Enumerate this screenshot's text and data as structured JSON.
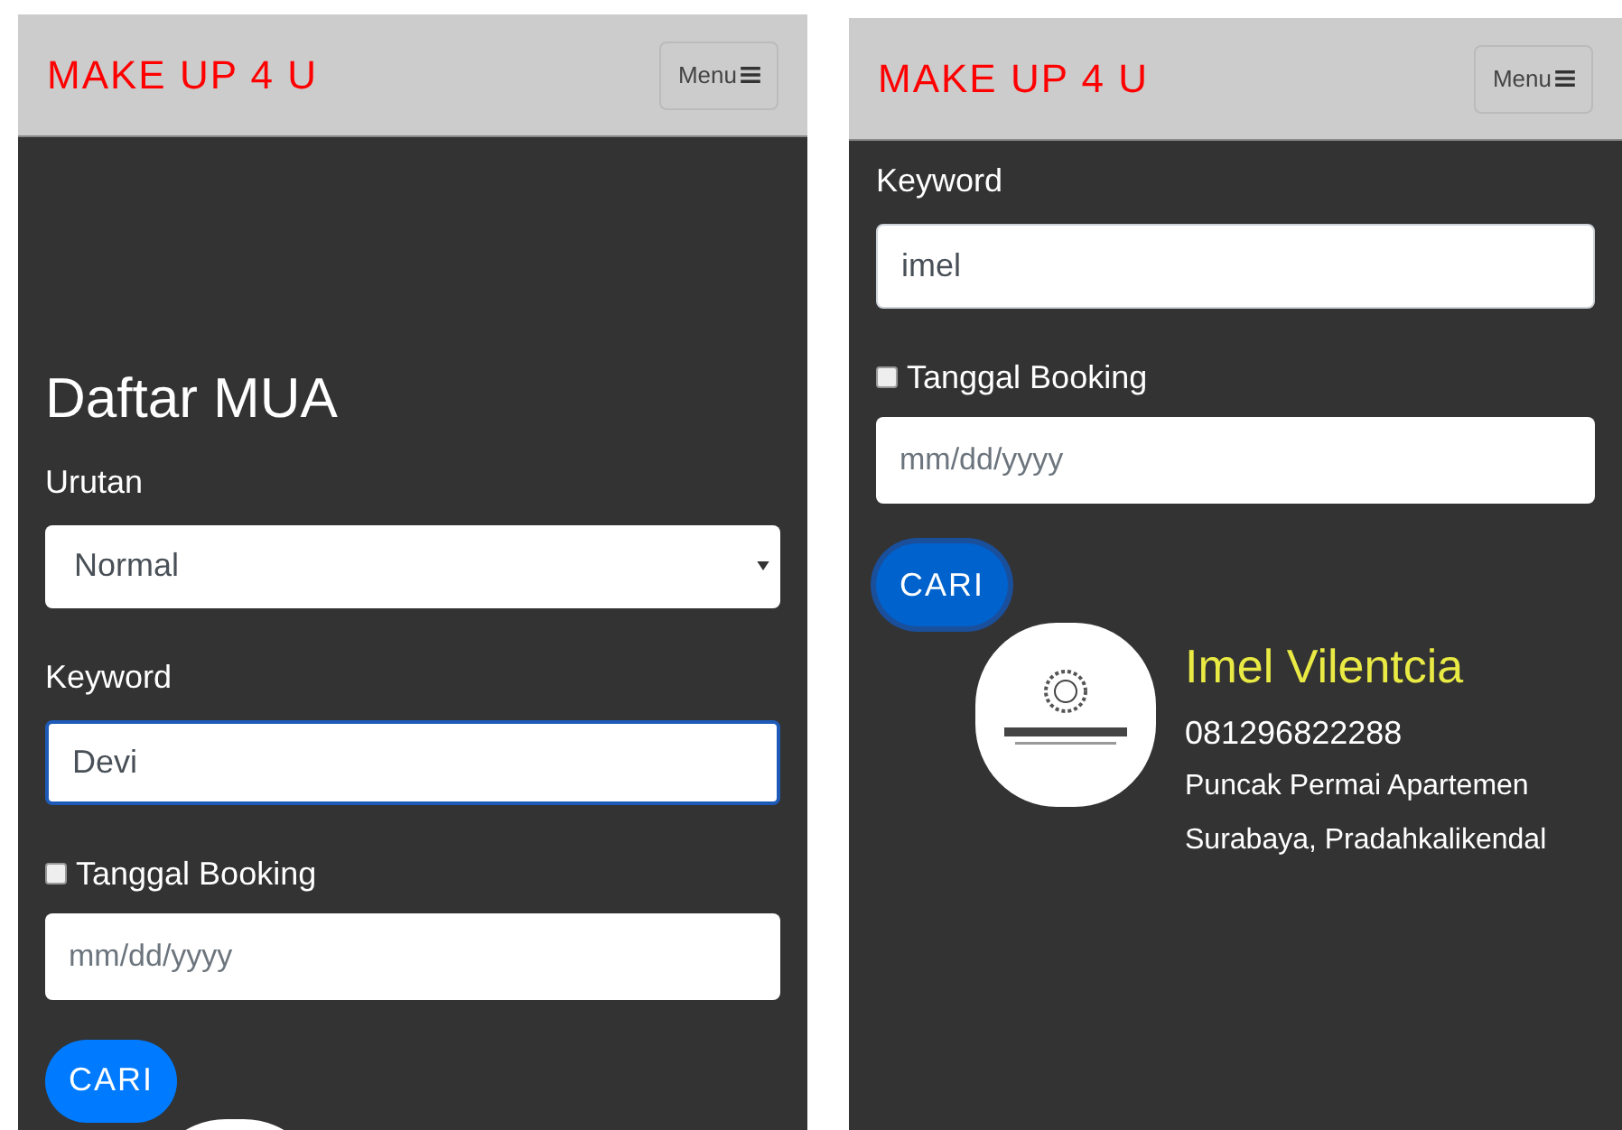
{
  "screens": [
    {
      "brand": "MAKE UP 4 U",
      "menu": "Menu",
      "items": [
        {
          "kind": "heading",
          "text": "Daftar MUA"
        },
        {
          "kind": "label",
          "text": "Urutan"
        },
        {
          "kind": "select",
          "value": "Normal"
        },
        {
          "kind": "label",
          "text": "Keyword"
        },
        {
          "kind": "input",
          "value": "Devi",
          "focused": true
        },
        {
          "kind": "checkbox",
          "label": "Tanggal Booking",
          "checked": false
        },
        {
          "kind": "date",
          "placeholder": "mm/dd/yyyy"
        },
        {
          "kind": "button",
          "label": "CARI",
          "focused": false
        },
        {
          "kind": "result_image"
        }
      ]
    },
    {
      "brand": "MAKE UP 4 U",
      "menu": "Menu",
      "items": [
        {
          "kind": "label",
          "text": "Keyword"
        },
        {
          "kind": "input",
          "value": "imel",
          "focused": false
        },
        {
          "kind": "checkbox",
          "label": "Tanggal Booking",
          "checked": false
        },
        {
          "kind": "date",
          "placeholder": "mm/dd/yyyy"
        },
        {
          "kind": "button",
          "label": "CARI",
          "focused": true
        },
        {
          "kind": "result",
          "name": "Imel Vilentcia",
          "phone": "081296822288",
          "address": [
            "Puncak Permai Apartemen",
            "Surabaya, Pradahkalikendal"
          ]
        }
      ]
    }
  ]
}
